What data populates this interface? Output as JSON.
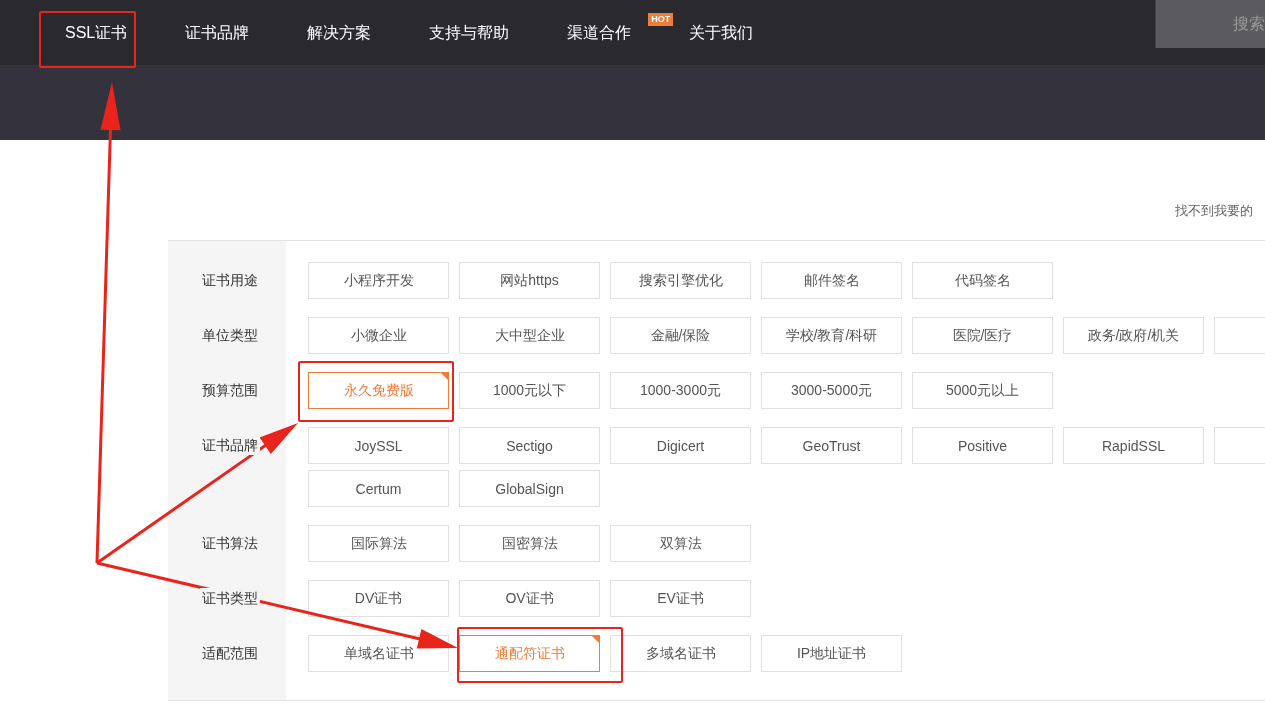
{
  "nav": {
    "items": [
      {
        "label": "SSL证书"
      },
      {
        "label": "证书品牌"
      },
      {
        "label": "解决方案"
      },
      {
        "label": "支持与帮助"
      },
      {
        "label": "渠道合作",
        "badge": "HOT"
      },
      {
        "label": "关于我们"
      }
    ],
    "search": {
      "placeholder": "搜索"
    }
  },
  "hint": "找不到我要的",
  "filters": [
    {
      "label": "证书用途",
      "options": [
        {
          "label": "小程序开发",
          "selected": false
        },
        {
          "label": "网站https",
          "selected": false
        },
        {
          "label": "搜索引擎优化",
          "selected": false
        },
        {
          "label": "邮件签名",
          "selected": false
        },
        {
          "label": "代码签名",
          "selected": false
        }
      ]
    },
    {
      "label": "单位类型",
      "options": [
        {
          "label": "小微企业",
          "selected": false
        },
        {
          "label": "大中型企业",
          "selected": false
        },
        {
          "label": "金融/保险",
          "selected": false
        },
        {
          "label": "学校/教育/科研",
          "selected": false
        },
        {
          "label": "医院/医疗",
          "selected": false
        },
        {
          "label": "政务/政府/机关",
          "selected": false
        },
        {
          "selected": false
        }
      ]
    },
    {
      "label": "预算范围",
      "options": [
        {
          "label": "永久免费版",
          "selected": true
        },
        {
          "label": "1000元以下",
          "selected": false
        },
        {
          "label": "1000-3000元",
          "selected": false
        },
        {
          "label": "3000-5000元",
          "selected": false
        },
        {
          "label": "5000元以上",
          "selected": false
        }
      ]
    },
    {
      "label": "证书品牌",
      "options": [
        {
          "label": "JoySSL",
          "selected": false
        },
        {
          "label": "Sectigo",
          "selected": false
        },
        {
          "label": "Digicert",
          "selected": false
        },
        {
          "label": "GeoTrust",
          "selected": false
        },
        {
          "label": "Positive",
          "selected": false
        },
        {
          "label": "RapidSSL",
          "selected": false
        },
        {
          "selected": false
        },
        {
          "label": "Certum",
          "selected": false
        },
        {
          "label": "GlobalSign",
          "selected": false
        }
      ]
    },
    {
      "label": "证书算法",
      "options": [
        {
          "label": "国际算法",
          "selected": false
        },
        {
          "label": "国密算法",
          "selected": false
        },
        {
          "label": "双算法",
          "selected": false
        }
      ]
    },
    {
      "label": "证书类型",
      "options": [
        {
          "label": "DV证书",
          "selected": false
        },
        {
          "label": "OV证书",
          "selected": false
        },
        {
          "label": "EV证书",
          "selected": false
        }
      ]
    },
    {
      "label": "适配范围",
      "options": [
        {
          "label": "单域名证书",
          "selected": false
        },
        {
          "label": "通配符证书",
          "selected": true
        },
        {
          "label": "多域名证书",
          "selected": false
        },
        {
          "label": "IP地址证书",
          "selected": false
        }
      ]
    }
  ]
}
